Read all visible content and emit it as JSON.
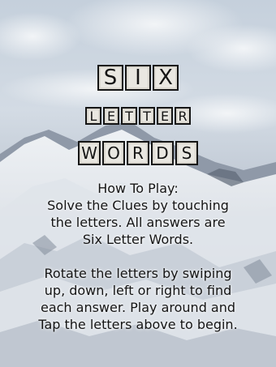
{
  "title": {
    "word1": [
      "S",
      "I",
      "X"
    ],
    "word2": [
      "L",
      "E",
      "T",
      "T",
      "E",
      "R"
    ],
    "word3": [
      "W",
      "O",
      "R",
      "D",
      "S"
    ]
  },
  "instructions": {
    "heading": "How To Play:",
    "para1": [
      "Solve the Clues by touching",
      "the letters. All answers are",
      "Six Letter Words."
    ],
    "para2": [
      "Rotate the letters by swiping",
      "up, down, left or right to find",
      "each answer. Play around and",
      "Tap the letters above to begin."
    ]
  },
  "colors": {
    "sky": "#cfd8e2",
    "tile": "#e9e7e1",
    "tile_border": "#151515",
    "text": "#151515"
  }
}
